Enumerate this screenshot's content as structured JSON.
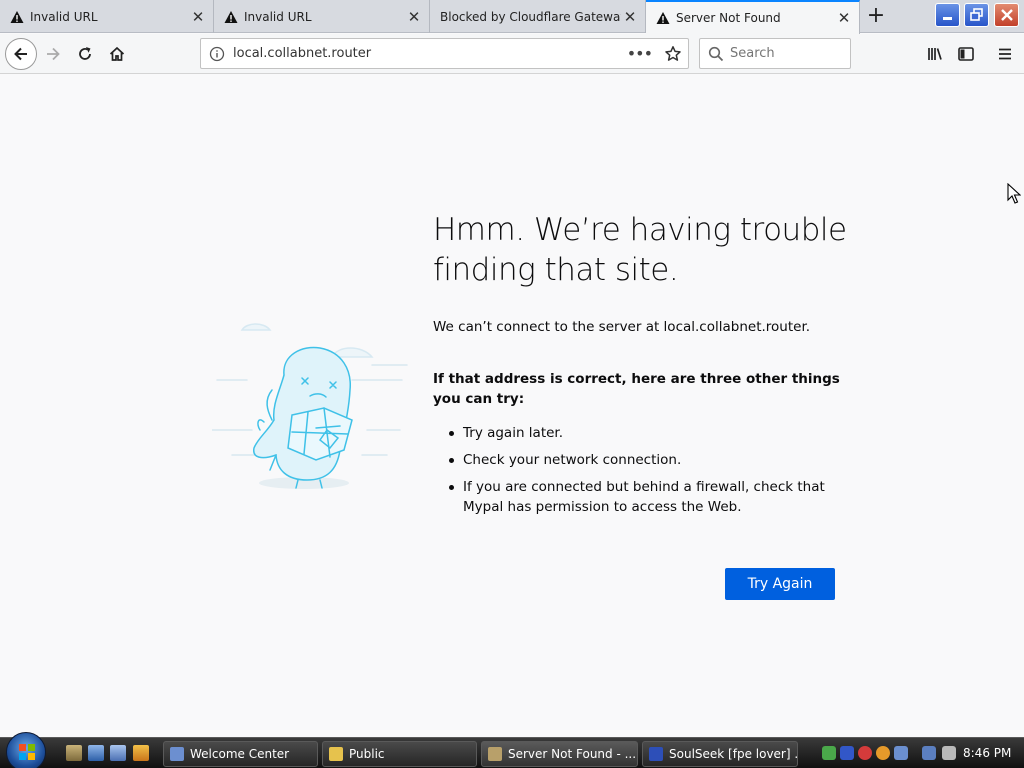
{
  "tabs": [
    {
      "label": "Invalid URL",
      "icon": "warning-icon",
      "active": false
    },
    {
      "label": "Invalid URL",
      "icon": "warning-icon",
      "active": false
    },
    {
      "label": "Blocked by Cloudflare Gateway",
      "icon": "",
      "active": false
    },
    {
      "label": "Server Not Found",
      "icon": "warning-icon",
      "active": true
    }
  ],
  "navbar": {
    "url": "local.collabnet.router",
    "search_placeholder": "Search"
  },
  "error": {
    "title": "Hmm. We’re having trouble finding that site.",
    "description": "We can’t connect to the server at local.collabnet.router.",
    "suggestions_heading": "If that address is correct, here are three other things you can try:",
    "suggestions": [
      "Try again later.",
      "Check your network connection.",
      "If you are connected but behind a firewall, check that Mypal has permission to access the Web."
    ],
    "try_again_label": "Try Again"
  },
  "taskbar": {
    "tasks": [
      {
        "label": "Welcome Center"
      },
      {
        "label": "Public"
      },
      {
        "label": "Server Not Found - ..."
      },
      {
        "label": "SoulSeek [fpe lover] ..."
      }
    ],
    "clock": "8:46 PM"
  },
  "colors": {
    "accent": "#0a84ff",
    "button": "#0060df",
    "illustration": "#3fc1e8"
  }
}
